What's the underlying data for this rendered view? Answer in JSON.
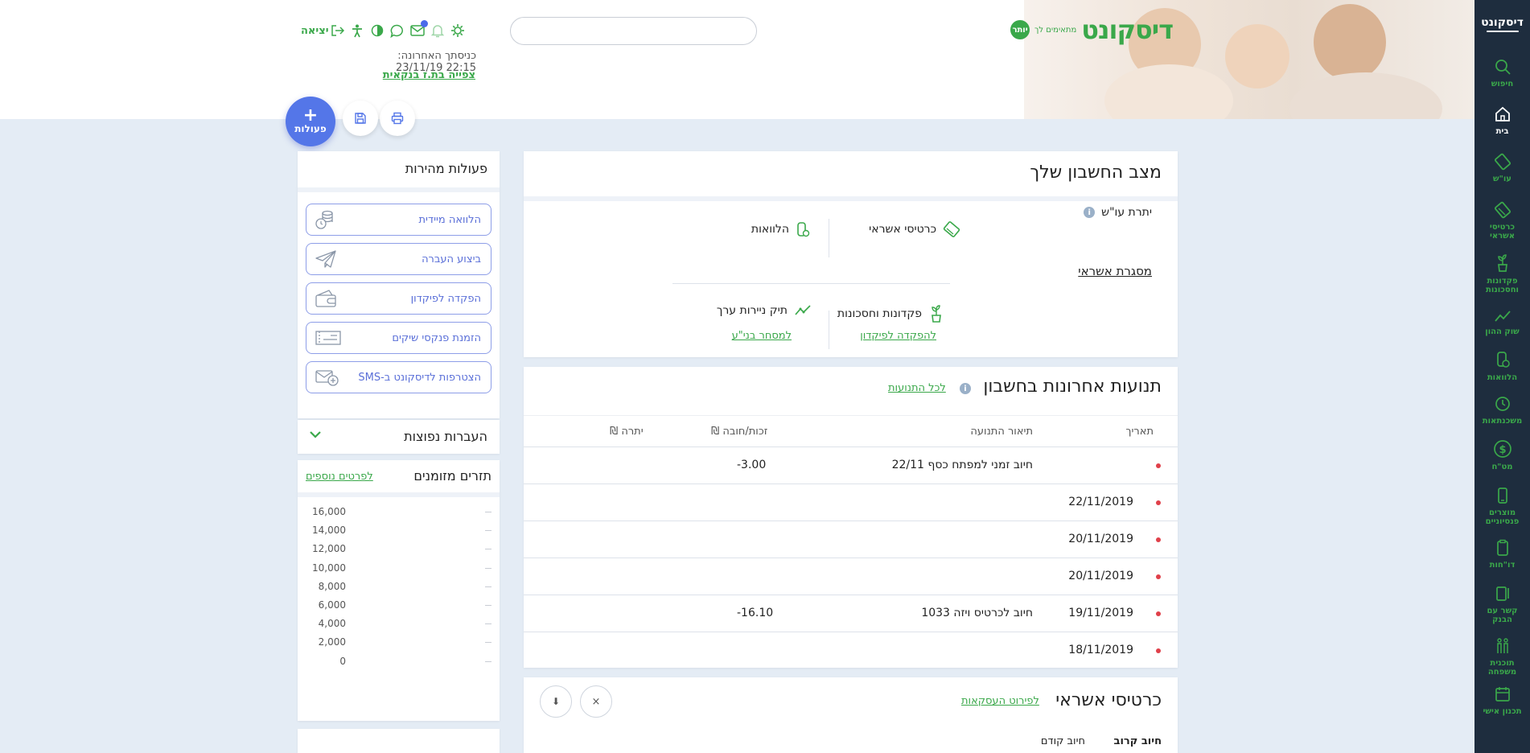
{
  "header": {
    "logo": {
      "main": "דיסקונט",
      "sub": "מתאימים לך",
      "badge": "יותר"
    },
    "search": {
      "placeholder": ""
    },
    "logout_label": "יציאה",
    "last_login_label": "כניסתך האחרונה:",
    "last_login_value": "23/11/19 22:15",
    "id_link": "צפייה בת.ז בנקאית",
    "actions_label": "פעולות",
    "icons": [
      "gear-icon",
      "bell-icon",
      "mail-icon",
      "chat-icon",
      "contrast-icon",
      "accessibility-icon",
      "logout-icon"
    ]
  },
  "sidebar": {
    "logo": "דיסקונט",
    "items": [
      {
        "label": "חיפוש",
        "icon": "search-icon"
      },
      {
        "label": "בית",
        "icon": "home-icon",
        "active": true
      },
      {
        "label": "עו\"ש",
        "icon": "card-icon"
      },
      {
        "label": "כרטיסי אשראי",
        "icon": "credit-card-icon"
      },
      {
        "label": "פקדונות וחסכונות",
        "icon": "plant-icon"
      },
      {
        "label": "שוק ההון",
        "icon": "chart-icon"
      },
      {
        "label": "הלוואות",
        "icon": "loan-icon"
      },
      {
        "label": "משכנתאות",
        "icon": "clock-icon"
      },
      {
        "label": "מט\"ח",
        "icon": "dollar-icon"
      },
      {
        "label": "מוצרים פנסיוניים",
        "icon": "phone-icon"
      },
      {
        "label": "דו\"חות",
        "icon": "clipboard-icon"
      },
      {
        "label": "קשר עם הבנק",
        "icon": "contact-icon"
      },
      {
        "label": "תוכנית משפחה",
        "icon": "family-icon"
      },
      {
        "label": "תכנון אישי",
        "icon": "calendar-icon"
      }
    ]
  },
  "account": {
    "title": "מצב החשבון שלך",
    "balance_label": "יתרת עו\"ש",
    "credit_frame": "מסגרת אשראי",
    "tiles": {
      "credit_cards": "כרטיסי אשראי",
      "loans": "הלוואות",
      "deposits": "פקדונות וחסכונות",
      "deposit_link": "להפקדה לפיקדון",
      "securities": "תיק ניירות ערך",
      "trade_link": "למסחר בני\"ע"
    }
  },
  "transactions": {
    "title": "תנועות אחרונות בחשבון",
    "all_link": "לכל התנועות",
    "columns": {
      "date": "תאריך",
      "desc": "תיאור התנועה",
      "amount": "זכות/חובה ₪",
      "balance": "יתרה ₪"
    },
    "rows": [
      {
        "date": "",
        "desc": "חיוב זמני למפתח כסף 22/11",
        "amount": "-3.00"
      },
      {
        "date": "22/11/2019",
        "desc": "",
        "amount": ""
      },
      {
        "date": "20/11/2019",
        "desc": "",
        "amount": ""
      },
      {
        "date": "20/11/2019",
        "desc": "",
        "amount": ""
      },
      {
        "date": "19/11/2019",
        "desc": "חיוב לכרטיס ויזה 1033",
        "amount": "-16.10"
      },
      {
        "date": "18/11/2019",
        "desc": "",
        "amount": ""
      }
    ]
  },
  "credit_cards": {
    "title": "כרטיסי אשראי",
    "details_link": "לפירוט העסקאות",
    "next_charge": "חיוב קרוב",
    "prev_charge": "חיוב קודם",
    "close_icon": "×",
    "download_icon": "⬇"
  },
  "quick_actions": {
    "title": "פעולות מהירות",
    "items": [
      {
        "label": "הלוואה מיידית",
        "icon": "coins-icon"
      },
      {
        "label": "ביצוע העברה",
        "icon": "paper-plane-icon"
      },
      {
        "label": "הפקדה לפיקדון",
        "icon": "wallet-icon"
      },
      {
        "label": "הזמנת פנקסי שיקים",
        "icon": "checkbook-icon"
      },
      {
        "label": "הצטרפות לדיסקונט ב-SMS",
        "icon": "sms-icon"
      }
    ]
  },
  "pending": {
    "title": "העברות נפוצות"
  },
  "cash_flow": {
    "title": "תזרים מזומנים",
    "link": "לפרטים נוספים",
    "y_ticks": [
      "16,000",
      "14,000",
      "12,000",
      "10,000",
      "8,000",
      "6,000",
      "4,000",
      "2,000",
      "0"
    ]
  },
  "colors": {
    "brand_green": "#3aa84a",
    "accent_blue": "#5476e8",
    "sidebar_bg": "#1e2d3e",
    "alert_red": "#e0404a"
  }
}
